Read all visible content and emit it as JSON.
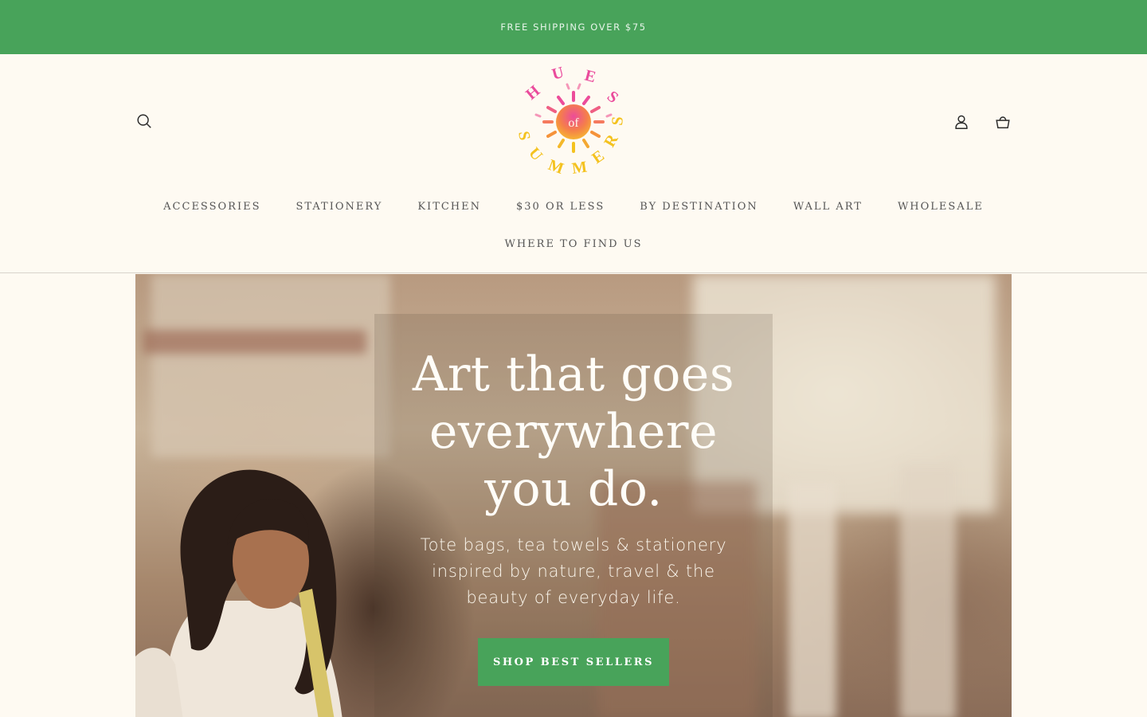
{
  "announcement": {
    "text": "FREE SHIPPING OVER $75"
  },
  "logo": {
    "letters": [
      "H",
      "U",
      "E",
      "S",
      "of",
      "S",
      "U",
      "M",
      "M",
      "E",
      "R",
      "S"
    ],
    "colors": {
      "pink": "#ea4b9c",
      "orange": "#f5933a",
      "yellow": "#f4c21f"
    }
  },
  "header": {
    "icons": {
      "search": "search-icon",
      "account": "user-icon",
      "cart": "bag-icon"
    }
  },
  "nav": {
    "row1": [
      "ACCESSORIES",
      "STATIONERY",
      "KITCHEN",
      "$30 OR LESS",
      "BY DESTINATION",
      "WALL ART",
      "WHOLESALE"
    ],
    "row2": [
      "WHERE TO FIND US"
    ]
  },
  "hero": {
    "headline_line1": "Art that goes",
    "headline_line2": "everywhere",
    "headline_line3": "you do.",
    "subtext_line1": "Tote bags, tea towels & stationery",
    "subtext_line2": "inspired by nature, travel & the",
    "subtext_line3": "beauty of everyday life.",
    "cta_label": "SHOP BEST SELLERS"
  },
  "colors": {
    "brand_green": "#48a35a",
    "background": "#fefaf2"
  }
}
